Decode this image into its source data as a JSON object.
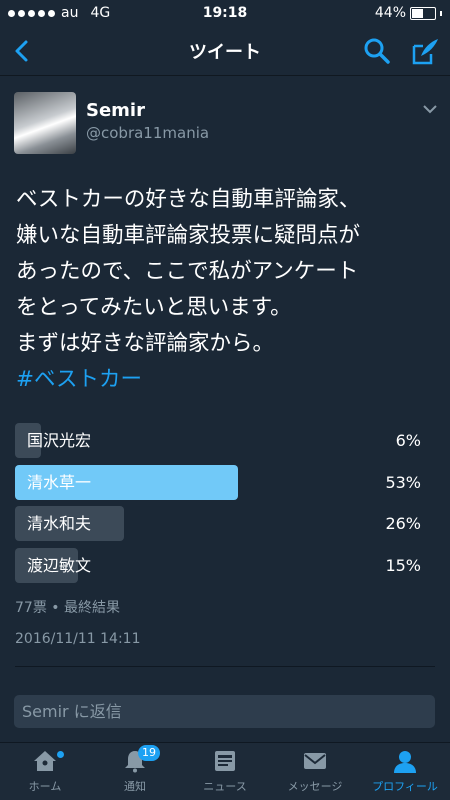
{
  "status_bar": {
    "carrier": "au",
    "network": "4G",
    "time": "19:18",
    "battery": "44%",
    "battery_level": 0.44
  },
  "nav": {
    "title": "ツイート",
    "back_icon": "chevron-left-icon",
    "search_icon": "search-icon",
    "compose_icon": "compose-icon"
  },
  "tweet": {
    "display_name": "Semir",
    "handle": "@cobra11mania",
    "text_lines": [
      "ベストカーの好きな自動車評論家、",
      "嫌いな自動車評論家投票に疑問点が",
      "あったので、ここで私がアンケート",
      "をとってみたいと思います。",
      "まずは好きな評論家から。"
    ],
    "hashtag": "#ベストカー",
    "timestamp": "2016/11/11 14:11"
  },
  "poll": {
    "options": [
      {
        "label": "国沢光宏",
        "percent_text": "6%",
        "percent": 6
      },
      {
        "label": "清水草一",
        "percent_text": "53%",
        "percent": 53
      },
      {
        "label": "清水和夫",
        "percent_text": "26%",
        "percent": 26
      },
      {
        "label": "渡辺敏文",
        "percent_text": "15%",
        "percent": 15
      }
    ],
    "meta": "77票 • 最終結果"
  },
  "reply": {
    "placeholder": "Semir に返信"
  },
  "tabbar": {
    "tabs": [
      {
        "label": "ホーム",
        "icon": "home-icon"
      },
      {
        "label": "通知",
        "icon": "bell-icon",
        "badge": "19"
      },
      {
        "label": "ニュース",
        "icon": "news-icon"
      },
      {
        "label": "メッセージ",
        "icon": "envelope-icon"
      },
      {
        "label": "プロフィール",
        "icon": "profile-icon"
      }
    ]
  },
  "colors": {
    "background": "#1b2836",
    "accent": "#1da1f2",
    "poll_leading": "#71c9f8",
    "poll_bar": "#3c4a58",
    "secondary_text": "#8899a6"
  }
}
